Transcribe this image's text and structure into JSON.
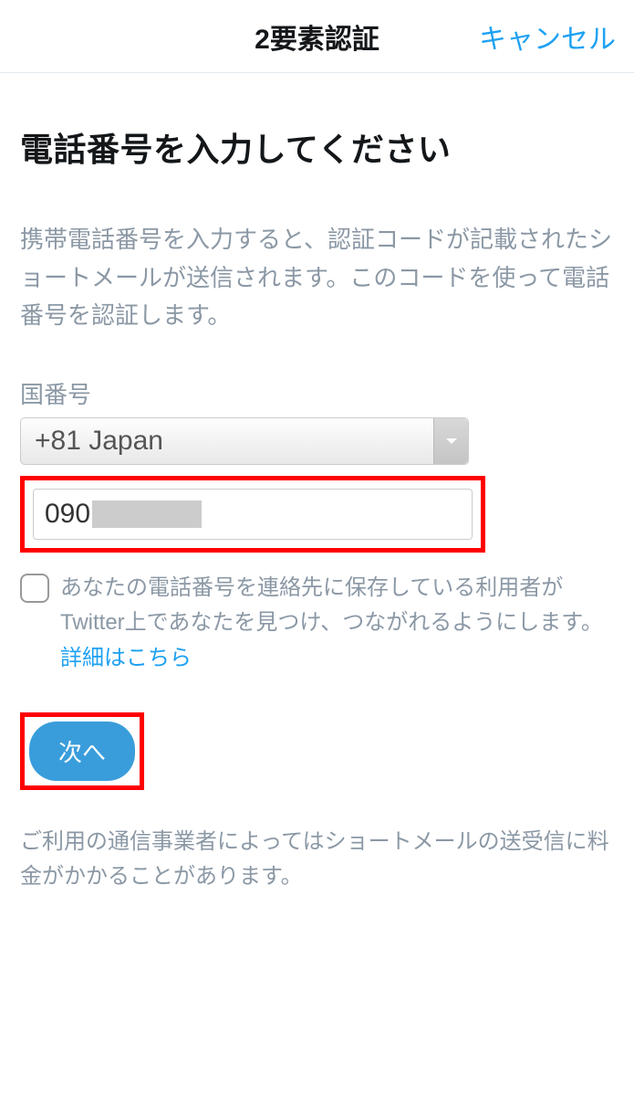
{
  "header": {
    "title": "2要素認証",
    "cancel": "キャンセル"
  },
  "main": {
    "page_title": "電話番号を入力してください",
    "description": "携帯電話番号を入力すると、認証コードが記載されたショートメールが送信されます。このコードを使って電話番号を認証します。",
    "country_label": "国番号",
    "country_value": "+81 Japan",
    "phone_prefix": "090",
    "checkbox_text": "あなたの電話番号を連絡先に保存している利用者がTwitter上であなたを見つけ、つながれるようにします。",
    "details_link": "詳細はこちら",
    "next_button": "次へ",
    "footer_note": "ご利用の通信事業者によってはショートメールの送受信に料金がかかることがあります。"
  }
}
